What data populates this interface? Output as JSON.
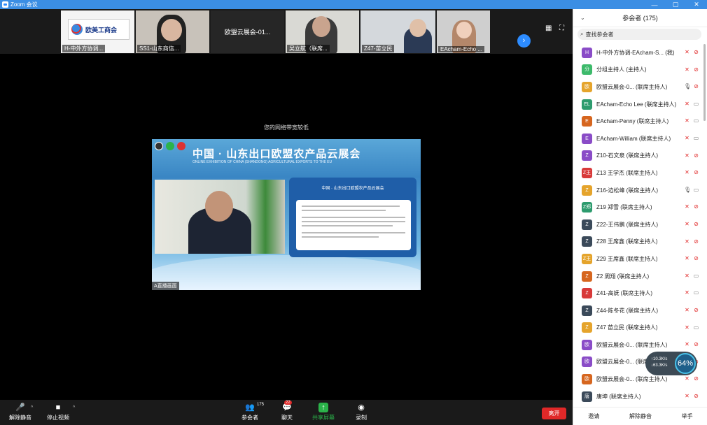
{
  "window": {
    "title": "Zoom 会议",
    "controls": [
      "—",
      "▢",
      "✕"
    ]
  },
  "gallery": {
    "tiles": [
      {
        "name": "H-中外方协调...",
        "type": "logo",
        "logo_text": "欧美工商会"
      },
      {
        "name": "SS1-山东商信...",
        "type": "person"
      },
      {
        "name": "",
        "type": "text",
        "center_text": "欧盟云展会-01..."
      },
      {
        "name": "吴立航（联席...",
        "type": "person"
      },
      {
        "name": "Z47-苗立民",
        "type": "person"
      },
      {
        "name": "EAcham-Echo ...",
        "type": "person"
      }
    ]
  },
  "stage": {
    "network_warning": "您的网络带宽较低",
    "share": {
      "title": "中国 · 山东出口欧盟农产品云展会",
      "subtitle": "ONLINE EXHIBITION OF CHINA (SHANDONG) AGRICULTURAL EXPORTS TO THE EU",
      "doc_title": "中国 · 山东出口欧盟农产品云展会",
      "presenter_label": "A直播画面"
    }
  },
  "toolbar": {
    "mute_label": "解除静音",
    "video_label": "停止视频",
    "participants_label": "参会者",
    "participants_count": "175",
    "chat_label": "聊天",
    "chat_badge": "22",
    "share_label": "共享屏幕",
    "record_label": "录制",
    "leave_label": "离开"
  },
  "panel": {
    "title": "参会者 (175)",
    "search_placeholder": "查找参会者",
    "participants": [
      {
        "avatar": "H",
        "color": "#8a4cc7",
        "name": "H-中外方协调-EAcham-S... (我)",
        "mic": "muted",
        "cam": "off"
      },
      {
        "avatar": "分",
        "color": "#3dba6b",
        "name": "分组主持人 (主持人)",
        "mic": "muted",
        "cam": "off"
      },
      {
        "avatar": "欧",
        "color": "#e5a42c",
        "name": "欧盟云展会-0... (联席主持人)",
        "mic": "on",
        "cam": "off"
      },
      {
        "avatar": "EL",
        "color": "#2d9b6e",
        "name": "EAcham-Echo Lee (联席主持人)",
        "mic": "muted",
        "cam": "on"
      },
      {
        "avatar": "E",
        "color": "#d6661f",
        "name": "EAcham-Penny (联席主持人)",
        "mic": "muted",
        "cam": "on"
      },
      {
        "avatar": "E",
        "color": "#8a4cc7",
        "name": "EAcham-William (联席主持人)",
        "mic": "muted",
        "cam": "on"
      },
      {
        "avatar": "Z",
        "color": "#8a4cc7",
        "name": "Z10-石文泉 (联席主持人)",
        "mic": "muted",
        "cam": "off"
      },
      {
        "avatar": "Z王",
        "color": "#d83a3a",
        "name": "Z13 王学杰 (联席主持人)",
        "mic": "muted",
        "cam": "off"
      },
      {
        "avatar": "Z",
        "color": "#e5a42c",
        "name": "Z16-边松峰 (联席主持人)",
        "mic": "on",
        "cam": "on"
      },
      {
        "avatar": "Z郑",
        "color": "#2d9b6e",
        "name": "Z19 郑雪 (联席主持人)",
        "mic": "muted",
        "cam": "off"
      },
      {
        "avatar": "Z",
        "color": "#3b4a5a",
        "name": "Z22-王伟鹏 (联席主持人)",
        "mic": "muted",
        "cam": "off"
      },
      {
        "avatar": "Z",
        "color": "#3b4a5a",
        "name": "Z28 王席鑫 (联席主持人)",
        "mic": "muted",
        "cam": "off"
      },
      {
        "avatar": "Z王",
        "color": "#e5a42c",
        "name": "Z29 王席鑫 (联席主持人)",
        "mic": "muted",
        "cam": "off"
      },
      {
        "avatar": "Z",
        "color": "#d6661f",
        "name": "Z2 周翔 (联席主持人)",
        "mic": "muted",
        "cam": "on"
      },
      {
        "avatar": "Z",
        "color": "#d83a3a",
        "name": "Z41-高妩 (联席主持人)",
        "mic": "muted",
        "cam": "on"
      },
      {
        "avatar": "Z",
        "color": "#3b4a5a",
        "name": "Z44-陈冬花 (联席主持人)",
        "mic": "muted",
        "cam": "off"
      },
      {
        "avatar": "Z",
        "color": "#e5a42c",
        "name": "Z47 苗立民 (联席主持人)",
        "mic": "muted",
        "cam": "on"
      },
      {
        "avatar": "欧",
        "color": "#8a4cc7",
        "name": "欧盟云展会-0... (联席主持人)",
        "mic": "muted",
        "cam": "off"
      },
      {
        "avatar": "欧",
        "color": "#8a4cc7",
        "name": "欧盟云展会-0... (联席主持人)",
        "mic": "muted",
        "cam": "off"
      },
      {
        "avatar": "欧",
        "color": "#d6661f",
        "name": "欧盟云展会-0... (联席主持人)",
        "mic": "muted",
        "cam": "off"
      },
      {
        "avatar": "唐",
        "color": "#3b4a5a",
        "name": "唐坤 (联席主持人)",
        "mic": "muted",
        "cam": "off"
      }
    ],
    "footer": {
      "invite": "邀请",
      "unmute_all": "解除静音",
      "raise_hand": "举手"
    }
  },
  "network_widget": {
    "upload": "10.3K/s",
    "download": "63.3K/s",
    "percent": "64%"
  }
}
